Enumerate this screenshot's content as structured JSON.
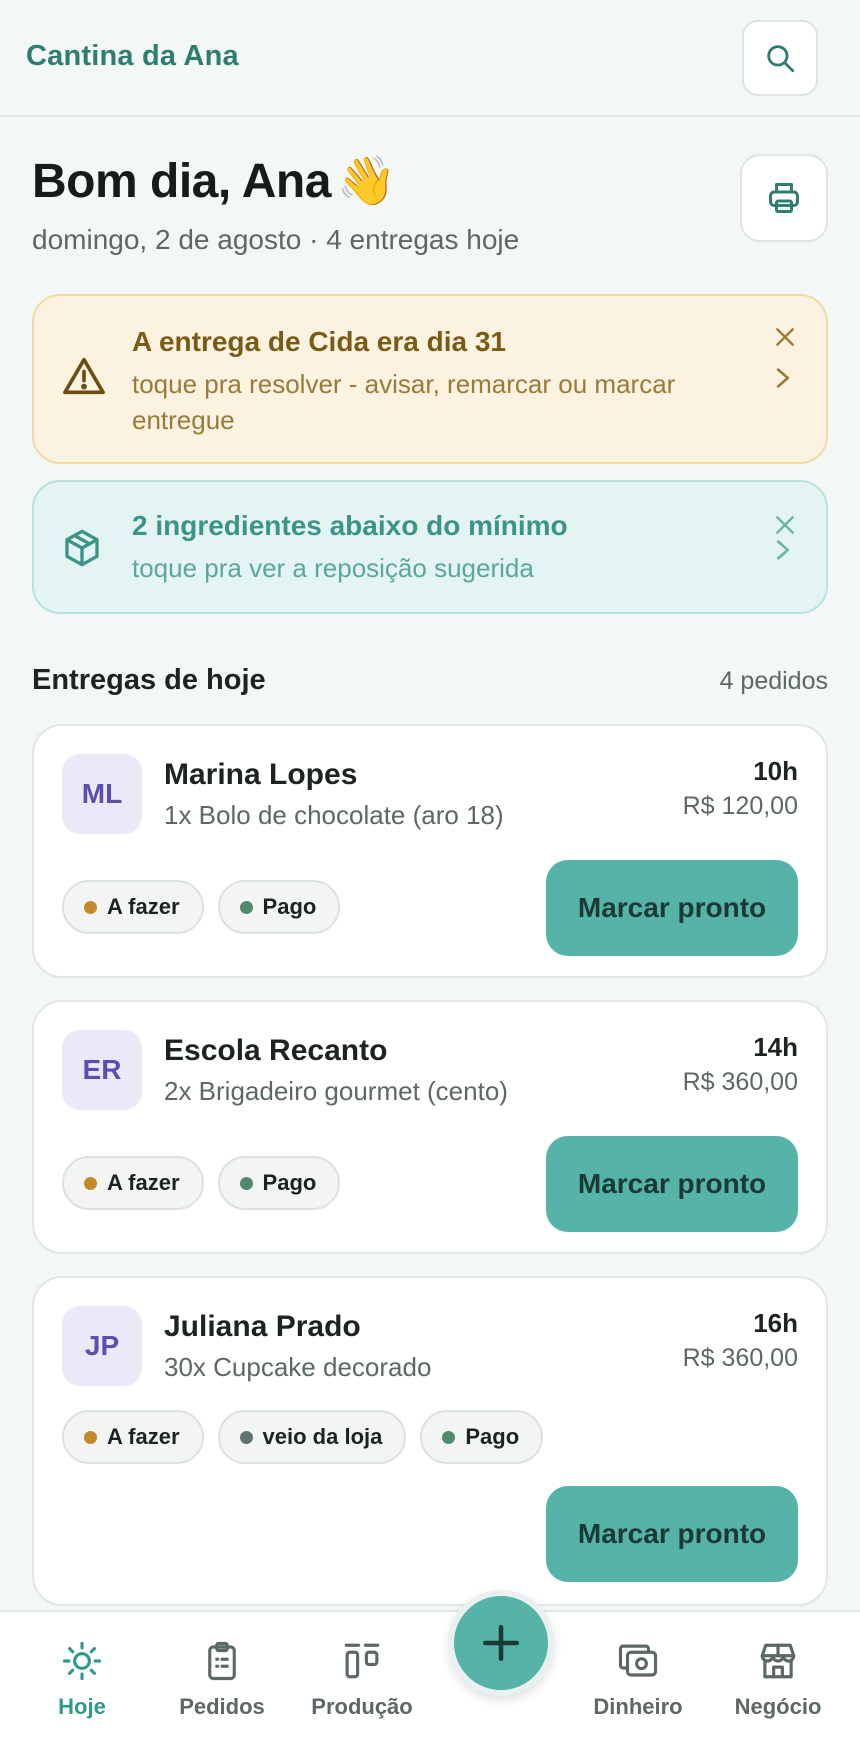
{
  "header": {
    "brand": "Cantina da Ana"
  },
  "greeting": {
    "title": "Bom dia, Ana",
    "emoji": "👋",
    "subtitle": "domingo, 2 de agosto · 4 entregas hoje"
  },
  "alerts": [
    {
      "title": "A entrega de Cida era dia 31",
      "description": "toque pra resolver - avisar, remarcar ou marcar entregue"
    },
    {
      "title": "2 ingredientes abaixo do mínimo",
      "description": "toque pra ver a reposição sugerida"
    }
  ],
  "section": {
    "title": "Entregas de hoje",
    "count": "4 pedidos"
  },
  "orders": [
    {
      "initials": "ML",
      "name": "Marina Lopes",
      "item": "1x Bolo de chocolate (aro 18)",
      "time": "10h",
      "price": "R$ 120,00",
      "chips": [
        {
          "label": "A fazer",
          "color": "#c48a2a"
        },
        {
          "label": "Pago",
          "color": "#4f8a6c"
        }
      ],
      "action": "Marcar pronto"
    },
    {
      "initials": "ER",
      "name": "Escola Recanto",
      "item": "2x Brigadeiro gourmet (cento)",
      "time": "14h",
      "price": "R$ 360,00",
      "chips": [
        {
          "label": "A fazer",
          "color": "#c48a2a"
        },
        {
          "label": "Pago",
          "color": "#4f8a6c"
        }
      ],
      "action": "Marcar pronto"
    },
    {
      "initials": "JP",
      "name": "Juliana Prado",
      "item": "30x Cupcake decorado",
      "time": "16h",
      "price": "R$ 360,00",
      "chips": [
        {
          "label": "A fazer",
          "color": "#c48a2a"
        },
        {
          "label": "veio da loja",
          "color": "#5f7370"
        },
        {
          "label": "Pago",
          "color": "#4f8a6c"
        }
      ],
      "action": "Marcar pronto"
    }
  ],
  "nav": {
    "items": [
      {
        "label": "Hoje",
        "icon": "sun-icon",
        "active": true
      },
      {
        "label": "Pedidos",
        "icon": "clipboard-icon"
      },
      {
        "label": "Produção",
        "icon": "production-icon"
      },
      {
        "label": "Dinheiro",
        "icon": "money-icon"
      },
      {
        "label": "Negócio",
        "icon": "store-icon"
      }
    ],
    "fab_icon": "plus-icon"
  },
  "colors": {
    "accent": "#56b3a7",
    "brand_text": "#2f7d71",
    "warn_bg": "#fbf3df",
    "info_bg": "#e4f4f2"
  }
}
